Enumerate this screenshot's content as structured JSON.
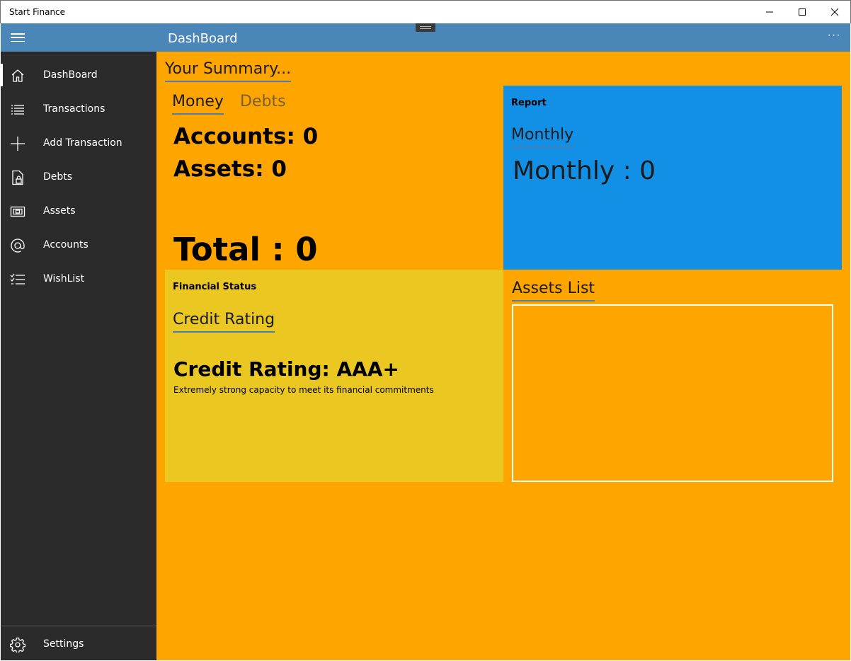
{
  "window": {
    "title": "Start Finance",
    "controls": [
      "minimize-icon",
      "maximize-icon",
      "close-icon"
    ]
  },
  "header": {
    "page_title": "DashBoard",
    "more_label": "···",
    "color": "#4a86b8"
  },
  "sidebar": {
    "items": [
      {
        "label": "DashBoard",
        "icon": "home-icon",
        "active": true
      },
      {
        "label": "Transactions",
        "icon": "list-icon"
      },
      {
        "label": "Add Transaction",
        "icon": "plus-icon"
      },
      {
        "label": "Debts",
        "icon": "lock-page-icon"
      },
      {
        "label": "Assets",
        "icon": "asset-icon"
      },
      {
        "label": "Accounts",
        "icon": "at-icon"
      },
      {
        "label": "WishList",
        "icon": "checklist-icon"
      }
    ],
    "settings": {
      "label": "Settings",
      "icon": "gear-icon"
    },
    "color": "#2b2b2b"
  },
  "main": {
    "summary_title": "Your Summary...",
    "money": {
      "tabs": [
        "Money",
        "Debts"
      ],
      "accounts": "Accounts: 0",
      "assets": "Assets: 0",
      "total": "Total : 0"
    },
    "report": {
      "heading": "Report",
      "tab": "Monthly",
      "value": "Monthly : 0",
      "color": "#1190e6"
    },
    "financial_status": {
      "heading": "Financial Status",
      "tab": "Credit Rating",
      "rating": "Credit Rating: AAA+",
      "description": "Extremely strong capacity to meet its financial commitments",
      "color": "#ebc722"
    },
    "assets_list": {
      "title": "Assets List"
    },
    "background": "#ffa500"
  }
}
